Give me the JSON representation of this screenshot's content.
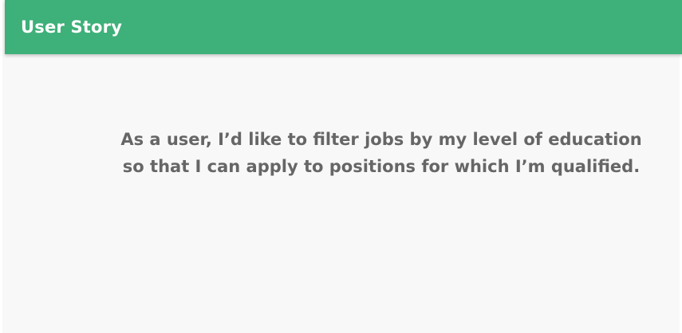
{
  "header": {
    "title": "User Story",
    "background_color": "#3eb079",
    "title_color": "#ffffff"
  },
  "story": {
    "line1": "As a user, I’d like to filter jobs by my level of education",
    "line2": "so that I can apply to positions for which I’m qualified.",
    "text_color": "#666666"
  },
  "page": {
    "background_color": "#f8f8f8"
  }
}
